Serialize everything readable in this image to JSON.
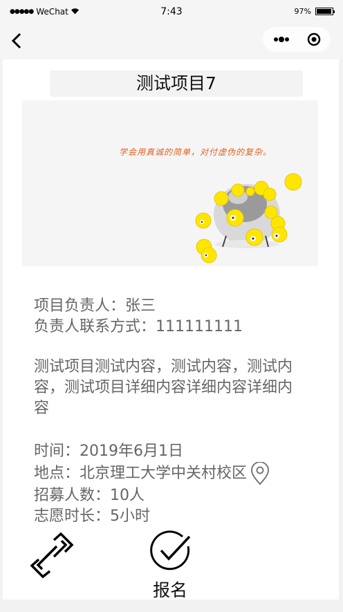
{
  "status_bar": {
    "signal": "●●●●●",
    "carrier": "WeChat",
    "time": "7:43",
    "battery_text": "97%",
    "battery_level": 0.97
  },
  "nav": {
    "back_icon": "chevron-left-icon",
    "more_icon": "more-dots-icon",
    "close_icon": "target-circle-icon"
  },
  "project": {
    "title": "测试项目7",
    "banner_caption": "学会用真诚的简单，对付虚伪的复杂。",
    "leader": "项目负责人：张三",
    "contact": "负责人联系方式：111111111",
    "description": "测试项目测试内容，测试内容，测试内容，测试项目详细内容详细内容详细内容",
    "time": "时间：2019年6月1日",
    "location": "地点：北京理工大学中关村校区",
    "recruit": "招募人数：10人",
    "duration": "志愿时长：5小时"
  },
  "actions": {
    "link_icon": "link-icon",
    "signup_icon": "check-circle-icon",
    "signup_label": "报名"
  },
  "colors": {
    "accent_text": "#e4611f",
    "chick_yellow": "#ffe600",
    "body_text": "#666666"
  }
}
